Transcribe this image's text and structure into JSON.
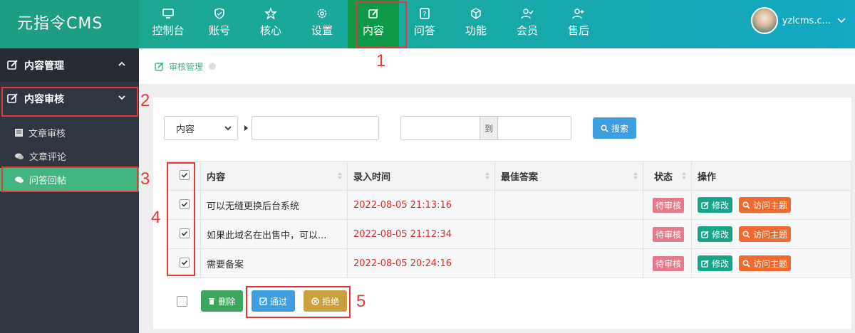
{
  "brand": {
    "logo": "元指令CMS"
  },
  "nav": [
    {
      "label": "控制台",
      "icon": "monitor-icon"
    },
    {
      "label": "账号",
      "icon": "shield-icon"
    },
    {
      "label": "核心",
      "icon": "star-icon"
    },
    {
      "label": "设置",
      "icon": "gear-icon"
    },
    {
      "label": "内容",
      "icon": "edit-icon",
      "active": true
    },
    {
      "label": "问答",
      "icon": "question-icon"
    },
    {
      "label": "功能",
      "icon": "cube-icon"
    },
    {
      "label": "会员",
      "icon": "user-check-icon"
    },
    {
      "label": "售后",
      "icon": "user-plus-icon"
    }
  ],
  "user": {
    "name": "yzlcms.c..."
  },
  "sidebar": {
    "group1": "内容管理",
    "group2": "内容审核",
    "items": [
      "文章审核",
      "文章评论",
      "问答回帖"
    ]
  },
  "breadcrumb": {
    "label": "审核管理"
  },
  "filter": {
    "select_value": "内容",
    "to_label": "到",
    "search_label": "搜索"
  },
  "table": {
    "headers": [
      "内容",
      "录入时间",
      "最佳答案",
      "状态",
      "操作"
    ],
    "rows": [
      {
        "content": "可以无缝更换后台系统",
        "time": "2022-08-05 21:13:16",
        "best": "",
        "status": "待审核"
      },
      {
        "content": "如果此域名在出售中，可以...",
        "time": "2022-08-05 21:12:34",
        "best": "",
        "status": "待审核"
      },
      {
        "content": "需要备案",
        "time": "2022-08-05 20:24:16",
        "best": "",
        "status": "待审核"
      }
    ],
    "edit_label": "修改",
    "visit_label": "访问主题"
  },
  "footer": {
    "delete_label": "删除",
    "pass_label": "通过",
    "reject_label": "拒绝"
  },
  "annotations": [
    "1",
    "2",
    "3",
    "4",
    "5"
  ],
  "colors": {
    "accent": "#0e9948",
    "highlight": "#e53935",
    "sidebar": "#2f3541",
    "active_item": "#43b581"
  }
}
